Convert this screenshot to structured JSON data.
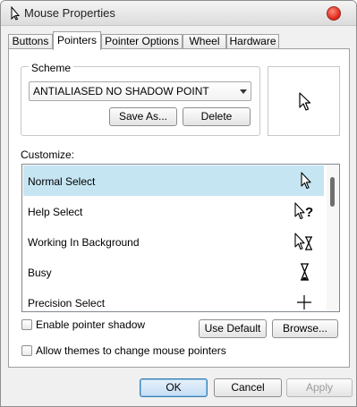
{
  "window": {
    "title": "Mouse Properties",
    "icon": "mouse-app-icon",
    "close_icon": "close-icon"
  },
  "tabs": [
    {
      "label": "Buttons",
      "active": false
    },
    {
      "label": "Pointers",
      "active": true
    },
    {
      "label": "Pointer Options",
      "active": false
    },
    {
      "label": "Wheel",
      "active": false
    },
    {
      "label": "Hardware",
      "active": false
    }
  ],
  "scheme": {
    "group_label": "Scheme",
    "selected": "ANTIALIASED NO SHADOW POINT",
    "save_as_label": "Save As...",
    "delete_label": "Delete"
  },
  "customize": {
    "label": "Customize:",
    "items": [
      {
        "label": "Normal Select",
        "icon": "arrow-pointer-icon",
        "selected": true
      },
      {
        "label": "Help Select",
        "icon": "help-pointer-icon",
        "selected": false
      },
      {
        "label": "Working In Background",
        "icon": "working-pointer-icon",
        "selected": false
      },
      {
        "label": "Busy",
        "icon": "hourglass-icon",
        "selected": false
      },
      {
        "label": "Precision Select",
        "icon": "crosshair-icon",
        "selected": false
      }
    ]
  },
  "options": {
    "enable_shadow_label": "Enable pointer shadow",
    "enable_shadow_checked": false,
    "allow_themes_label": "Allow themes to change mouse pointers",
    "allow_themes_checked": false,
    "use_default_label": "Use Default",
    "browse_label": "Browse..."
  },
  "footer": {
    "ok_label": "OK",
    "cancel_label": "Cancel",
    "apply_label": "Apply",
    "apply_enabled": false
  },
  "colors": {
    "selected_row": "#c6e5f3",
    "window_bg": "#f0f0f0",
    "panel_bg": "#ffffff",
    "close_button": "#e0281a",
    "ok_accent": "#3c7fb1"
  }
}
